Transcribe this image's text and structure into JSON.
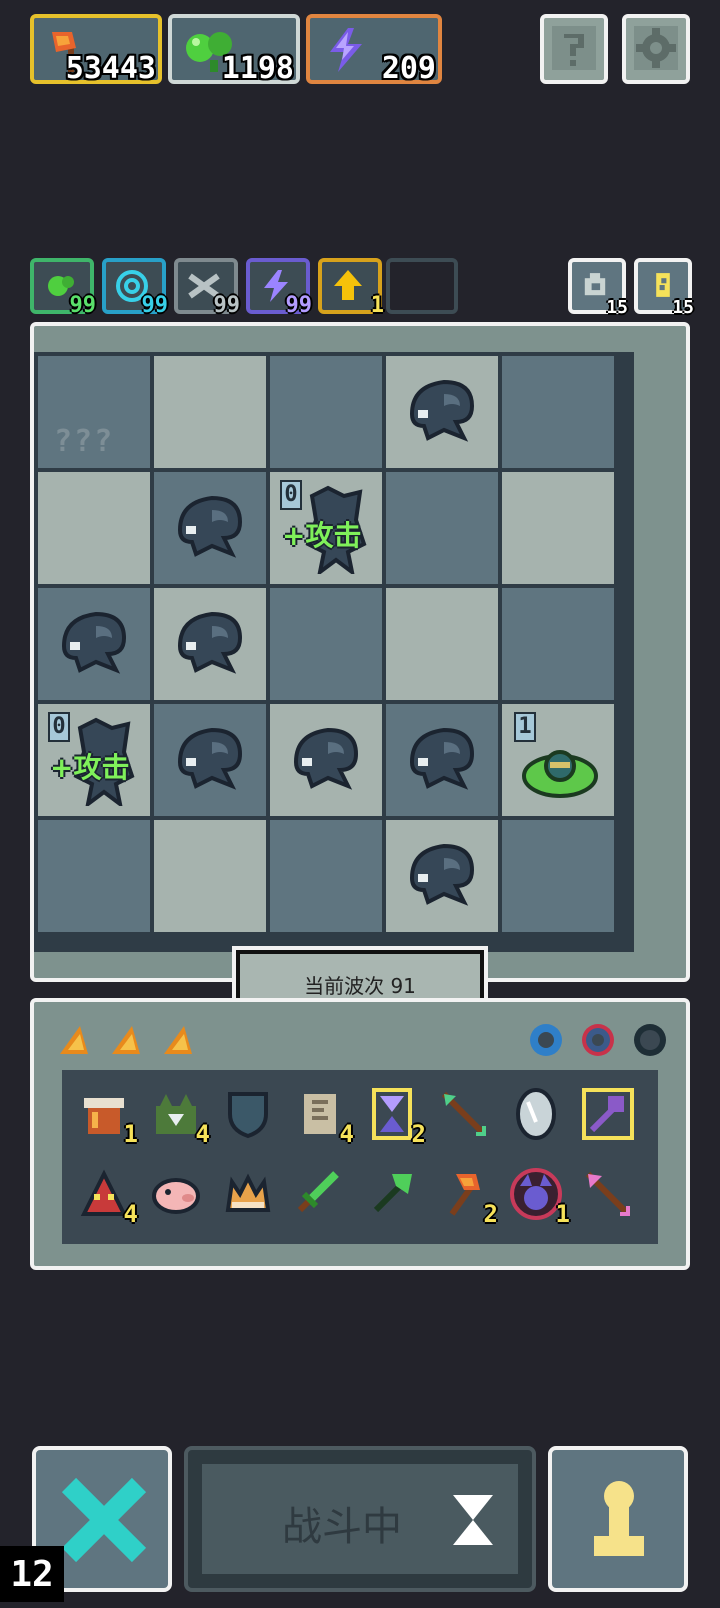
{
  "resources": [
    {
      "name": "axe-resource",
      "value": "53443",
      "border": "#e6c12b",
      "icon": "axe-icon"
    },
    {
      "name": "potion-resource",
      "value": "1198",
      "border": "#cfd8d6",
      "icon": "green-orb-icon"
    },
    {
      "name": "energy-resource",
      "value": "209",
      "border": "#e08540",
      "icon": "lightning-icon"
    }
  ],
  "top_buttons": [
    {
      "name": "help-button",
      "icon": "question-icon"
    },
    {
      "name": "settings-button",
      "icon": "gear-icon"
    }
  ],
  "indicators": [
    {
      "count": "99",
      "color": "#3fb56a",
      "text_color": "#5ae06b",
      "icon": "green-orb-icon"
    },
    {
      "count": "99",
      "color": "#28a0c8",
      "text_color": "#38d0e8",
      "icon": "swirl-icon"
    },
    {
      "count": "99",
      "color": "#7f8a8f",
      "text_color": "#b8c2c4",
      "icon": "sword-icon"
    },
    {
      "count": "99",
      "color": "#6a5cd0",
      "text_color": "#b39cff",
      "icon": "lightning-icon"
    },
    {
      "count": "1",
      "color": "#d7a21c",
      "text_color": "#f6e25a",
      "icon": "arrow-up-icon"
    }
  ],
  "side_counters": [
    {
      "name": "counter-refresh",
      "value": "15",
      "icon": "refresh-icon"
    },
    {
      "name": "counter-energy",
      "value": "15",
      "icon": "battery-icon"
    }
  ],
  "board": {
    "unknown_text": "???",
    "attack_text": "+攻击",
    "attack_level": "0",
    "slime_level": "1",
    "dark_color": "#5f7580",
    "light_color": "#a6b3ae"
  },
  "wave_label": "当前波次 91",
  "orbs": [
    "blue-orb-icon",
    "red-orb-icon",
    "dark-ring-icon"
  ],
  "inventory_row1": [
    {
      "icon": "brazier-icon",
      "count": "1"
    },
    {
      "icon": "green-cat-icon",
      "count": "4"
    },
    {
      "icon": "shield-icon",
      "count": ""
    },
    {
      "icon": "scroll-icon",
      "count": "4"
    },
    {
      "icon": "hourglass-icon",
      "count": "2"
    },
    {
      "icon": "arrow-icon",
      "count": ""
    },
    {
      "icon": "mirror-icon",
      "count": ""
    },
    {
      "icon": "golden-key-icon",
      "count": ""
    }
  ],
  "inventory_row2": [
    {
      "icon": "red-mask-icon",
      "count": "4"
    },
    {
      "icon": "pig-icon",
      "count": ""
    },
    {
      "icon": "crown-icon",
      "count": ""
    },
    {
      "icon": "green-sword-icon",
      "count": ""
    },
    {
      "icon": "green-axe-icon",
      "count": ""
    },
    {
      "icon": "fire-axe-icon",
      "count": "2"
    },
    {
      "icon": "demon-icon",
      "count": "1"
    },
    {
      "icon": "pink-arrow-icon",
      "count": ""
    }
  ],
  "fight_label": "战斗中",
  "speed_value": "12"
}
